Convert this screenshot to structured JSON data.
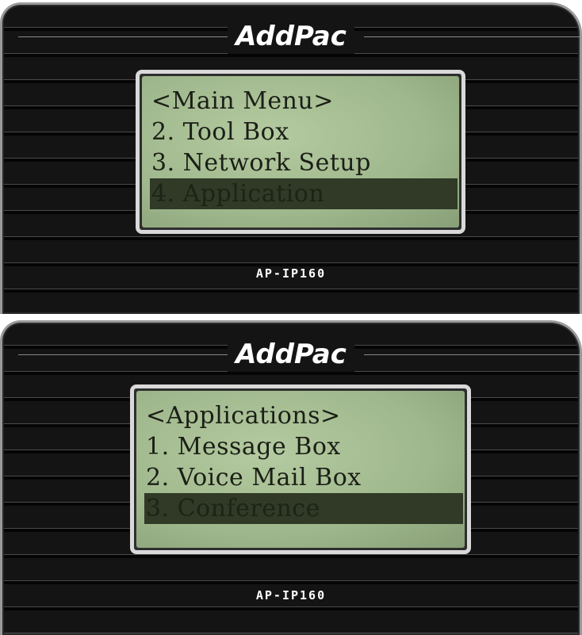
{
  "screens": [
    {
      "brand": "AddPac",
      "lines": [
        "<Main Menu>",
        "2. Tool Box",
        "3. Network Setup",
        "4. Application"
      ],
      "selected_index": 3,
      "model": "AP-IP160"
    },
    {
      "brand": "AddPac",
      "lines": [
        "<Applications>",
        "1. Message Box",
        "2. Voice Mail Box",
        "3. Conference"
      ],
      "selected_index": 3,
      "model": "AP-IP160"
    }
  ],
  "colors": {
    "lcd_background": "#a8c095",
    "lcd_text": "#1b1f16",
    "lcd_highlight": "#303a27",
    "panel": "#141414",
    "bezel": "#d9d9d9"
  }
}
